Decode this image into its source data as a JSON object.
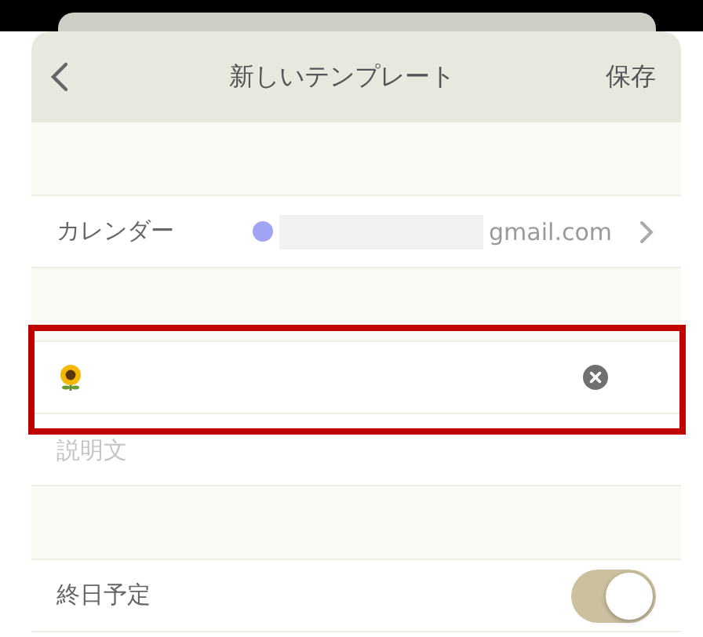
{
  "header": {
    "title": "新しいテンプレート",
    "save": "保存"
  },
  "calendar": {
    "label": "カレンダー",
    "color": "#a1a3f5",
    "account": "gmail.com"
  },
  "title_field": {
    "highlighted": true
  },
  "description_field": {
    "placeholder": "説明文"
  },
  "all_day": {
    "label": "終日予定",
    "on": true
  }
}
